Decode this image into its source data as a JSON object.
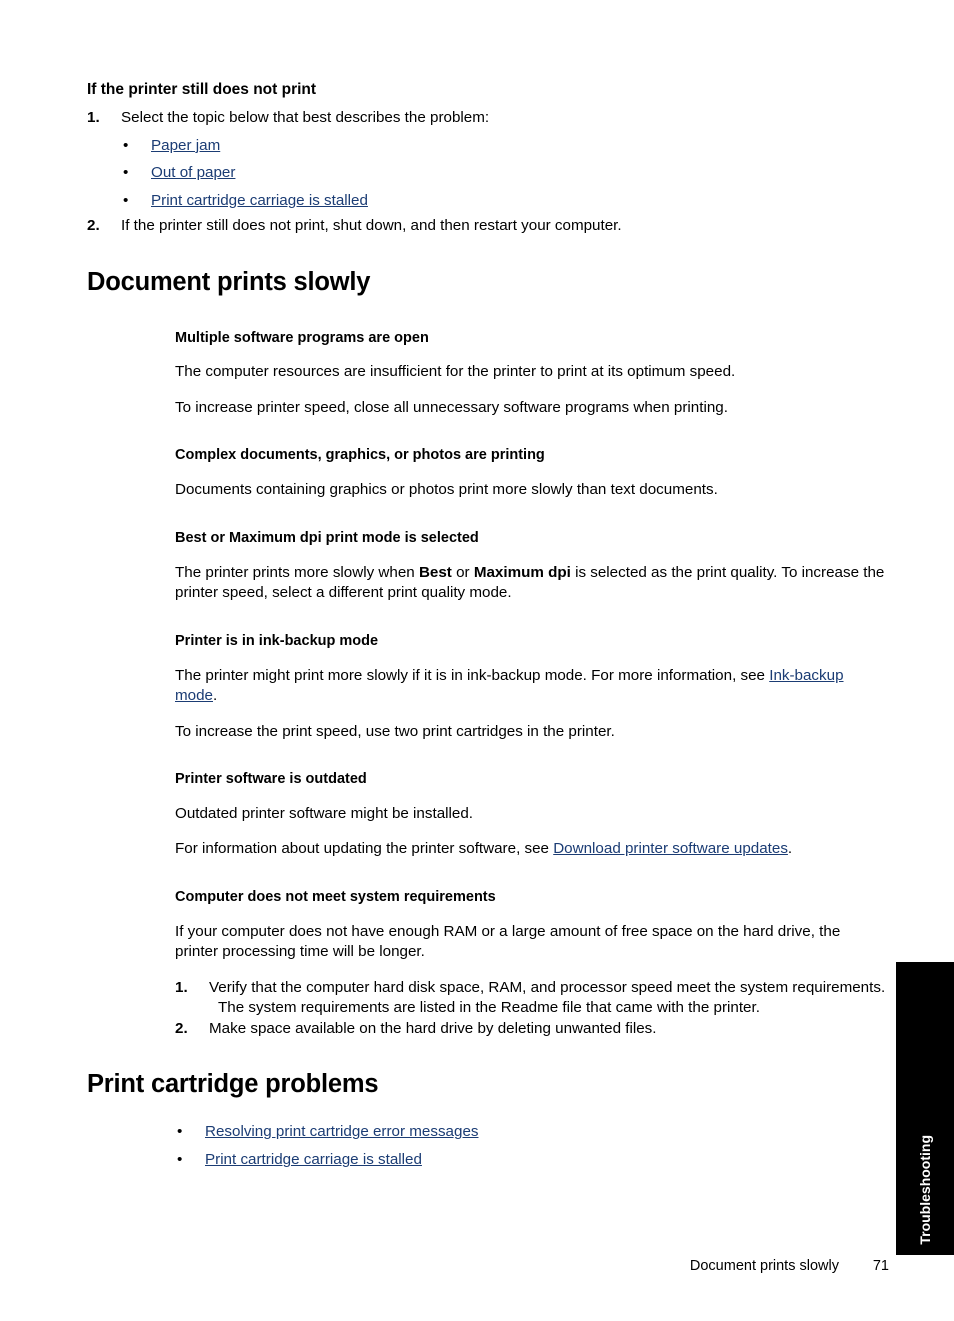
{
  "page": {
    "footer_title": "Document prints slowly",
    "page_number": "71",
    "side_tab_label": "Troubleshooting",
    "link_color": "#1b3c74"
  },
  "section_still_not_print": {
    "heading": "If the printer still does not print",
    "step1": {
      "number": "1.",
      "text": "Select the topic below that best describes the problem:"
    },
    "bullets": [
      {
        "marker": "•",
        "label": "Paper jam"
      },
      {
        "marker": "•",
        "label": "Out of paper"
      },
      {
        "marker": "•",
        "label": "Print cartridge carriage is stalled"
      }
    ],
    "step2": {
      "number": "2.",
      "text": "If the printer still does not print, shut down, and then restart your computer."
    }
  },
  "section_prints_slowly": {
    "heading": "Document prints slowly",
    "subsections": [
      {
        "heading": "Multiple software programs are open",
        "paragraphs": [
          "The computer resources are insufficient for the printer to print at its optimum speed.",
          "To increase printer speed, close all unnecessary software programs when printing."
        ]
      },
      {
        "heading": "Complex documents, graphics, or photos are printing",
        "paragraphs": [
          "Documents containing graphics or photos print more slowly than text documents."
        ]
      },
      {
        "heading": "Best or Maximum dpi print mode is selected",
        "rich_paragraph": {
          "part1": "The printer prints more slowly when ",
          "bold1": "Best",
          "part2": " or ",
          "bold2": "Maximum dpi",
          "part3": " is selected as the print quality. To increase the printer speed, select a different print quality mode."
        }
      },
      {
        "heading": "Printer is in ink-backup mode",
        "rich_paragraph": {
          "part1": "The printer might print more slowly if it is in ink-backup mode. For more information, see ",
          "link": "Ink-backup mode",
          "part2": "."
        },
        "paragraphs": [
          "To increase the print speed, use two print cartridges in the printer."
        ]
      },
      {
        "heading": "Printer software is outdated",
        "paragraphs": [
          "Outdated printer software might be installed."
        ],
        "rich_paragraph": {
          "part1": "For information about updating the printer software, see ",
          "link": "Download printer software updates",
          "part2": "."
        }
      },
      {
        "heading": "Computer does not meet system requirements",
        "paragraphs": [
          "If your computer does not have enough RAM or a large amount of free space on the hard drive, the printer processing time will be longer."
        ],
        "steps": [
          {
            "number": "1.",
            "text": "Verify that the computer hard disk space, RAM, and processor speed meet the system requirements.",
            "subparagraph": "The system requirements are listed in the Readme file that came with the printer."
          },
          {
            "number": "2.",
            "text": "Make space available on the hard drive by deleting unwanted files."
          }
        ]
      }
    ]
  },
  "section_cartridge_problems": {
    "heading": "Print cartridge problems",
    "bullets": [
      {
        "marker": "•",
        "label": "Resolving print cartridge error messages"
      },
      {
        "marker": "•",
        "label": "Print cartridge carriage is stalled"
      }
    ]
  }
}
